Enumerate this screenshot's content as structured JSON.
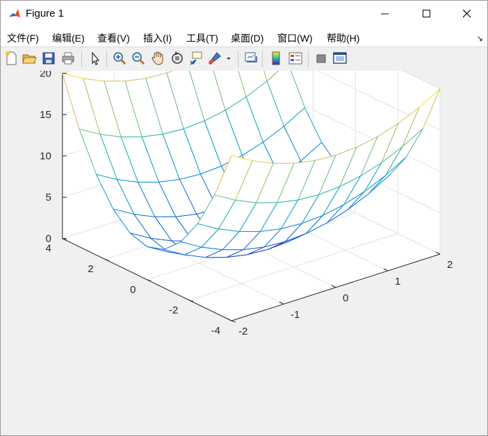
{
  "window": {
    "title": "Figure 1"
  },
  "menu": [
    {
      "label": "文件(F)"
    },
    {
      "label": "编辑(E)"
    },
    {
      "label": "查看(V)"
    },
    {
      "label": "插入(I)"
    },
    {
      "label": "工具(T)"
    },
    {
      "label": "桌面(D)"
    },
    {
      "label": "窗口(W)"
    },
    {
      "label": "帮助(H)"
    }
  ],
  "toolbar": [
    {
      "icon": "new-figure-icon"
    },
    {
      "icon": "open-file-icon"
    },
    {
      "icon": "save-icon"
    },
    {
      "icon": "print-icon"
    },
    {
      "icon": "pointer-icon"
    },
    {
      "icon": "zoom-in-icon"
    },
    {
      "icon": "zoom-out-icon"
    },
    {
      "icon": "pan-hand-icon"
    },
    {
      "icon": "rotate-3d-icon"
    },
    {
      "icon": "data-cursor-icon"
    },
    {
      "icon": "brush-icon"
    },
    {
      "icon": "link-plot-icon"
    },
    {
      "icon": "colorbar-icon"
    },
    {
      "icon": "legend-icon"
    },
    {
      "icon": "hide-plot-tools-icon"
    },
    {
      "icon": "show-plot-tools-icon"
    }
  ],
  "colors": {
    "titlebar": "#ffffff",
    "toolbar": "#f0f0f0",
    "axes_background": "#ffffff"
  },
  "chart_data": {
    "type": "surface-mesh",
    "function": "z = x^2 + y^2",
    "x": [
      -2,
      -1.6,
      -1.2,
      -0.8,
      -0.4,
      0,
      0.4,
      0.8,
      1.2,
      1.6,
      2
    ],
    "y": [
      -4,
      -3.2,
      -2.4,
      -1.6,
      -0.8,
      0,
      0.8,
      1.6,
      2.4,
      3.2,
      4
    ],
    "xlim": [
      -2,
      2
    ],
    "ylim": [
      -4,
      4
    ],
    "zlim": [
      0,
      20
    ],
    "x_ticks": [
      "-2",
      "-1",
      "0",
      "1",
      "2"
    ],
    "y_ticks": [
      "-4",
      "-2",
      "0",
      "2",
      "4"
    ],
    "z_ticks": [
      "0",
      "5",
      "10",
      "15",
      "20"
    ],
    "colormap": "parula",
    "grid": true,
    "box": false
  }
}
